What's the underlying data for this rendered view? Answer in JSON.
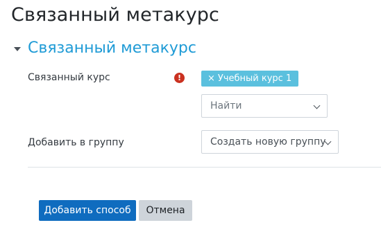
{
  "page": {
    "title": "Связанный метакурс"
  },
  "section": {
    "title": "Связанный метакурс",
    "expanded": true
  },
  "form": {
    "linked_course": {
      "label": "Связанный курс",
      "required_icon": "exclamation-circle-icon",
      "required_glyph": "!",
      "selected_chip": {
        "remove_glyph": "×",
        "label": "Учебный курс 1"
      },
      "search": {
        "placeholder": "Найти"
      }
    },
    "add_to_group": {
      "label": "Добавить в группу",
      "selected_value": "Создать новую группу"
    }
  },
  "actions": {
    "submit_label": "Добавить способ",
    "cancel_label": "Отмена"
  },
  "colors": {
    "section_title": "#1f9bd6",
    "chip_background": "#5bc0de",
    "primary_button": "#0f6cbf",
    "secondary_button": "#ced4da",
    "required_icon": "#ca3120"
  }
}
